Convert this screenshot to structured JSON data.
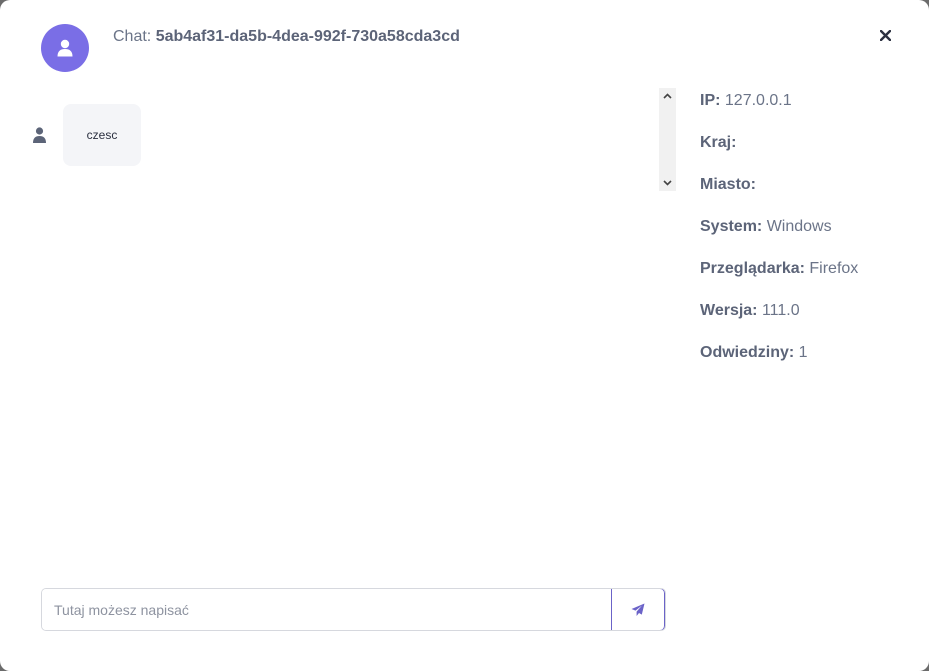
{
  "header": {
    "title_prefix": "Chat: ",
    "chat_id": "5ab4af31-da5b-4dea-992f-730a58cda3cd",
    "avatar_icon": "user-icon",
    "close_icon": "close-icon"
  },
  "messages": [
    {
      "text": "czesc",
      "icon": "user-icon"
    }
  ],
  "info": [
    {
      "label": "IP:",
      "value": " 127.0.0.1"
    },
    {
      "label": "Kraj:",
      "value": ""
    },
    {
      "label": "Miasto:",
      "value": ""
    },
    {
      "label": "System:",
      "value": " Windows"
    },
    {
      "label": "Przeglądarka:",
      "value": " Firefox"
    },
    {
      "label": "Wersja:",
      "value": " 111.0"
    },
    {
      "label": "Odwiedziny:",
      "value": " 1"
    }
  ],
  "composer": {
    "placeholder": "Tutaj możesz napisać",
    "value": "",
    "send_icon": "paper-plane-icon"
  },
  "colors": {
    "accent": "#7a6ee6",
    "send_icon": "#6b63c8",
    "text_label": "#5c6478",
    "bubble_bg": "#f4f5f8"
  }
}
